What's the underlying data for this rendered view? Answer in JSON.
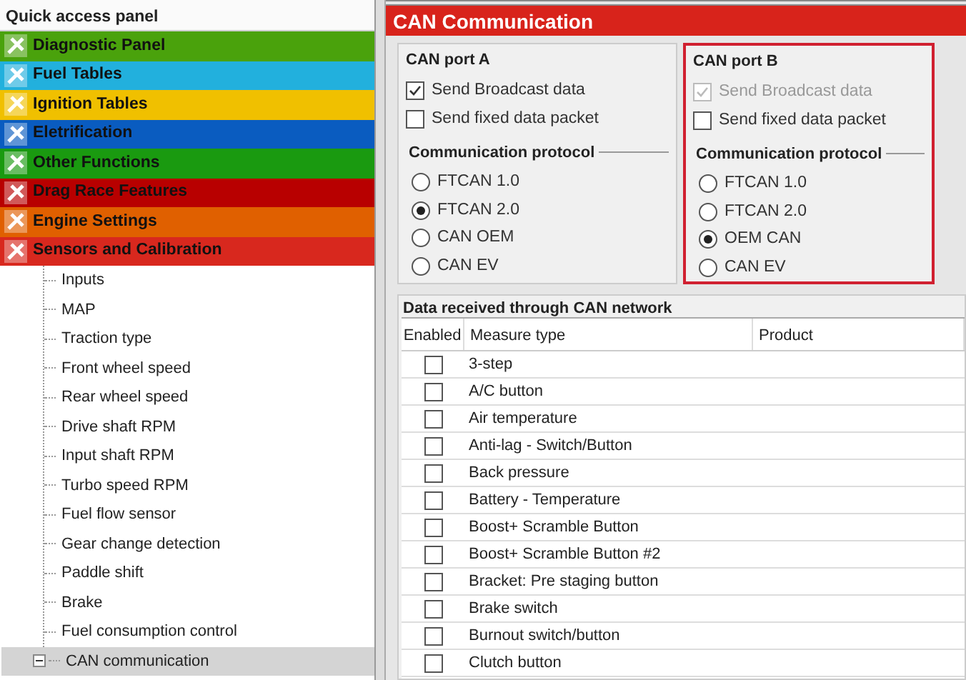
{
  "quick_access_panel": {
    "title": "Quick access panel",
    "sections": [
      {
        "label": "Diagnostic Panel",
        "color": "#4aa20c"
      },
      {
        "label": "Fuel Tables",
        "color": "#22b0dd"
      },
      {
        "label": "Ignition Tables",
        "color": "#f0c000"
      },
      {
        "label": "Eletrification",
        "color": "#0a5cc0"
      },
      {
        "label": "Other Functions",
        "color": "#1a9a10"
      },
      {
        "label": "Drag Race Features",
        "color": "#b80000"
      },
      {
        "label": "Engine Settings",
        "color": "#e06000"
      },
      {
        "label": "Sensors and Calibration",
        "color": "#d8281e",
        "children": [
          {
            "label": "Inputs",
            "selected": false
          },
          {
            "label": "MAP",
            "selected": false
          },
          {
            "label": "Traction type",
            "selected": false
          },
          {
            "label": "Front wheel speed",
            "selected": false
          },
          {
            "label": "Rear wheel speed",
            "selected": false
          },
          {
            "label": "Drive shaft RPM",
            "selected": false
          },
          {
            "label": "Input shaft RPM",
            "selected": false
          },
          {
            "label": "Turbo speed RPM",
            "selected": false
          },
          {
            "label": "Fuel flow sensor",
            "selected": false
          },
          {
            "label": "Gear change detection",
            "selected": false
          },
          {
            "label": "Paddle shift",
            "selected": false
          },
          {
            "label": "Brake",
            "selected": false
          },
          {
            "label": "Fuel consumption control",
            "selected": false
          },
          {
            "label": "CAN communication",
            "selected": true,
            "expanded": true
          }
        ]
      }
    ]
  },
  "page": {
    "title": "CAN Communication",
    "ports": [
      {
        "title": "CAN port A",
        "highlighted": false,
        "options": [
          {
            "label": "Send Broadcast data",
            "checked": true,
            "disabled": false
          },
          {
            "label": "Send fixed data packet",
            "checked": false,
            "disabled": false
          }
        ],
        "protocol_title": "Communication protocol",
        "protocols": [
          {
            "label": "FTCAN 1.0",
            "selected": false
          },
          {
            "label": "FTCAN 2.0",
            "selected": true
          },
          {
            "label": "CAN OEM",
            "selected": false
          },
          {
            "label": "CAN EV",
            "selected": false
          }
        ]
      },
      {
        "title": "CAN port B",
        "highlighted": true,
        "options": [
          {
            "label": "Send Broadcast data",
            "checked": true,
            "disabled": true
          },
          {
            "label": "Send fixed data packet",
            "checked": false,
            "disabled": false
          }
        ],
        "protocol_title": "Communication protocol",
        "protocols": [
          {
            "label": "FTCAN 1.0",
            "selected": false
          },
          {
            "label": "FTCAN 2.0",
            "selected": false
          },
          {
            "label": "OEM CAN",
            "selected": true
          },
          {
            "label": "CAN EV",
            "selected": false
          }
        ]
      }
    ],
    "table": {
      "title": "Data received through CAN network",
      "columns": [
        "Enabled",
        "Measure type",
        "Product"
      ],
      "rows": [
        {
          "enabled": false,
          "measure_type": "3-step"
        },
        {
          "enabled": false,
          "measure_type": "A/C button"
        },
        {
          "enabled": false,
          "measure_type": "Air temperature"
        },
        {
          "enabled": false,
          "measure_type": "Anti-lag - Switch/Button"
        },
        {
          "enabled": false,
          "measure_type": "Back pressure"
        },
        {
          "enabled": false,
          "measure_type": "Battery - Temperature"
        },
        {
          "enabled": false,
          "measure_type": "Boost+ Scramble Button"
        },
        {
          "enabled": false,
          "measure_type": "Boost+ Scramble Button #2"
        },
        {
          "enabled": false,
          "measure_type": "Bracket: Pre staging button"
        },
        {
          "enabled": false,
          "measure_type": "Brake switch"
        },
        {
          "enabled": false,
          "measure_type": "Burnout switch/button"
        },
        {
          "enabled": false,
          "measure_type": "Clutch button"
        }
      ]
    }
  }
}
